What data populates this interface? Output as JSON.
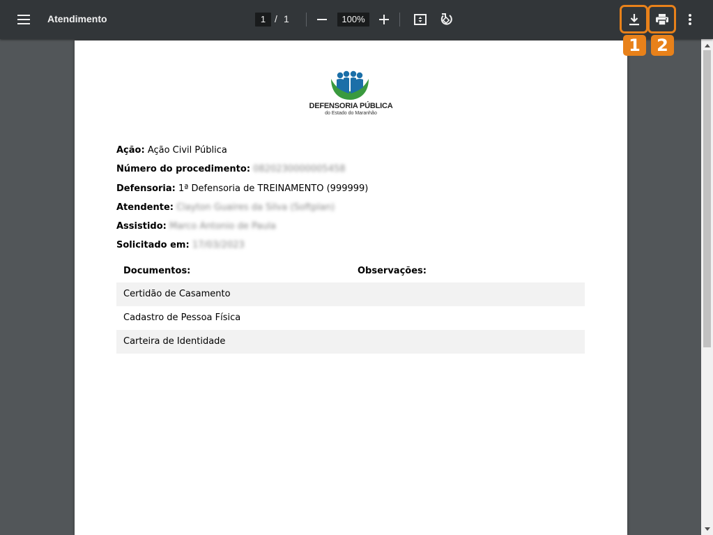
{
  "toolbar": {
    "title": "Atendimento",
    "current_page": "1",
    "page_separator": "/",
    "total_pages": "1",
    "zoom": "100%",
    "icons": {
      "menu": "menu-icon",
      "zoom_out": "minus-icon",
      "zoom_in": "plus-icon",
      "fit": "fit-page-icon",
      "rotate": "rotate-icon",
      "download": "download-icon",
      "print": "print-icon",
      "more": "more-vert-icon"
    }
  },
  "annotations": {
    "badge_1": "1",
    "badge_2": "2",
    "color": "#e8811a"
  },
  "document": {
    "org_name": "DEFENSORIA PÚBLICA",
    "org_sub": "do Estado do Maranhão",
    "fields": [
      {
        "label": "Ação:",
        "value": "Ação Civil Pública",
        "blurred": false
      },
      {
        "label": "Número do procedimento:",
        "value": "0820230000005458",
        "blurred": true
      },
      {
        "label": "Defensoria:",
        "value": "1ª Defensoria de TREINAMENTO (999999)",
        "blurred": false
      },
      {
        "label": "Atendente:",
        "value": "Clayton Guaires da Silva (Softplan)",
        "blurred": true
      },
      {
        "label": "Assistido:",
        "value": "Marco Antonio de Paula",
        "blurred": true
      },
      {
        "label": "Solicitado em:",
        "value": "17/03/2023",
        "blurred": true
      }
    ],
    "table": {
      "headers": [
        "Documentos:",
        "Observações:"
      ],
      "rows": [
        "Certidão de Casamento",
        "Cadastro de Pessoa Física",
        "Carteira de Identidade"
      ]
    }
  },
  "colors": {
    "toolbar_bg": "#323639",
    "viewer_bg": "#525659",
    "logo_green": "#3a9a3e",
    "logo_blue": "#1b6fa8"
  }
}
